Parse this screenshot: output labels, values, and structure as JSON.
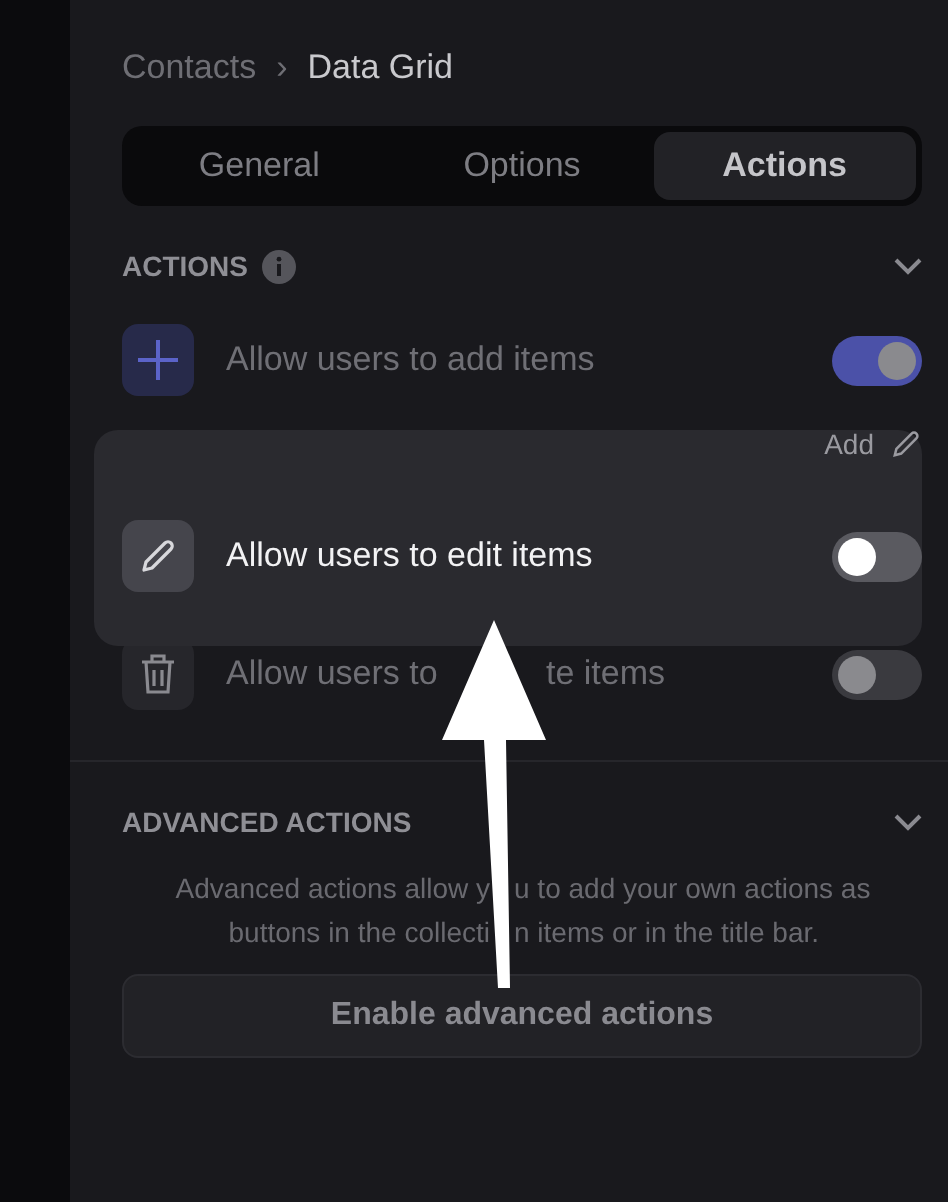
{
  "breadcrumb": {
    "parent": "Contacts",
    "separator": "›",
    "current": "Data Grid"
  },
  "tabs": [
    {
      "label": "General",
      "selected": false
    },
    {
      "label": "Options",
      "selected": false
    },
    {
      "label": "Actions",
      "selected": true
    }
  ],
  "actions_section": {
    "title": "ACTIONS",
    "expanded": true,
    "rows": [
      {
        "kind": "add",
        "label": "Allow users to add items",
        "on": true,
        "highlighted": false
      },
      {
        "kind": "edit",
        "label": "Allow users to edit items",
        "on": false,
        "highlighted": true,
        "link": "Add"
      },
      {
        "kind": "delete",
        "label": "Allow users to",
        "label_end": "te items",
        "on": false,
        "highlighted": false
      }
    ]
  },
  "advanced_section": {
    "title": "ADVANCED ACTIONS",
    "expanded": true,
    "description_lines": [
      [
        "Advanced actions allow y",
        "u to add your own actions as"
      ],
      [
        "buttons in the collecti",
        "n items or in the title bar."
      ]
    ],
    "button": "Enable advanced actions"
  }
}
